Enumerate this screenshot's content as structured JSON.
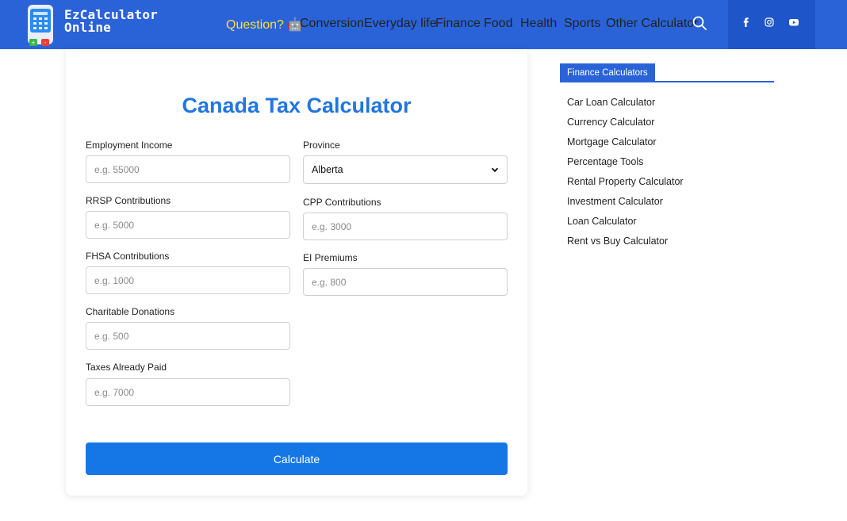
{
  "header": {
    "logo_line1": "EzCalculator",
    "logo_line2": "Online",
    "nav": [
      {
        "label": "Question? 🤖",
        "id": "question"
      },
      {
        "label": "Conversion",
        "id": "conversion"
      },
      {
        "label": "Everyday life",
        "id": "everyday-life"
      },
      {
        "label": "Finance",
        "id": "finance"
      },
      {
        "label": "Food",
        "id": "food"
      },
      {
        "label": "Health",
        "id": "health"
      },
      {
        "label": "Sports",
        "id": "sports"
      },
      {
        "label": "Other Calculator",
        "id": "other-calculator"
      }
    ],
    "search_icon": "search-icon",
    "social": [
      "facebook-icon",
      "instagram-icon",
      "youtube-icon"
    ],
    "colors": {
      "bar": "#2a63d8",
      "social_bg": "#1e55c9",
      "question": "#ffdf3d"
    }
  },
  "main": {
    "title": "Canada Tax Calculator",
    "fields": {
      "employment_income": {
        "label": "Employment Income",
        "placeholder": "e.g. 55000"
      },
      "province": {
        "label": "Province",
        "value": "Alberta"
      },
      "rrsp": {
        "label": "RRSP Contributions",
        "placeholder": "e.g. 5000"
      },
      "cpp": {
        "label": "CPP Contributions",
        "placeholder": "e.g. 3000"
      },
      "fhsa": {
        "label": "FHSA Contributions",
        "placeholder": "e.g. 1000"
      },
      "ei": {
        "label": "EI Premiums",
        "placeholder": "e.g. 800"
      },
      "donations": {
        "label": "Charitable Donations",
        "placeholder": "e.g. 500"
      },
      "taxes_paid": {
        "label": "Taxes Already Paid",
        "placeholder": "e.g. 7000"
      }
    },
    "calculate_label": "Calculate",
    "colors": {
      "title": "#2276df",
      "button": "#1577e6"
    }
  },
  "sidebar": {
    "heading": "Finance Calculators",
    "links": [
      "Car Loan Calculator",
      "Currency Calculator",
      "Mortgage Calculator",
      "Percentage Tools",
      "Rental Property Calculator",
      "Investment Calculator",
      "Loan Calculator",
      "Rent vs Buy Calculator"
    ]
  }
}
